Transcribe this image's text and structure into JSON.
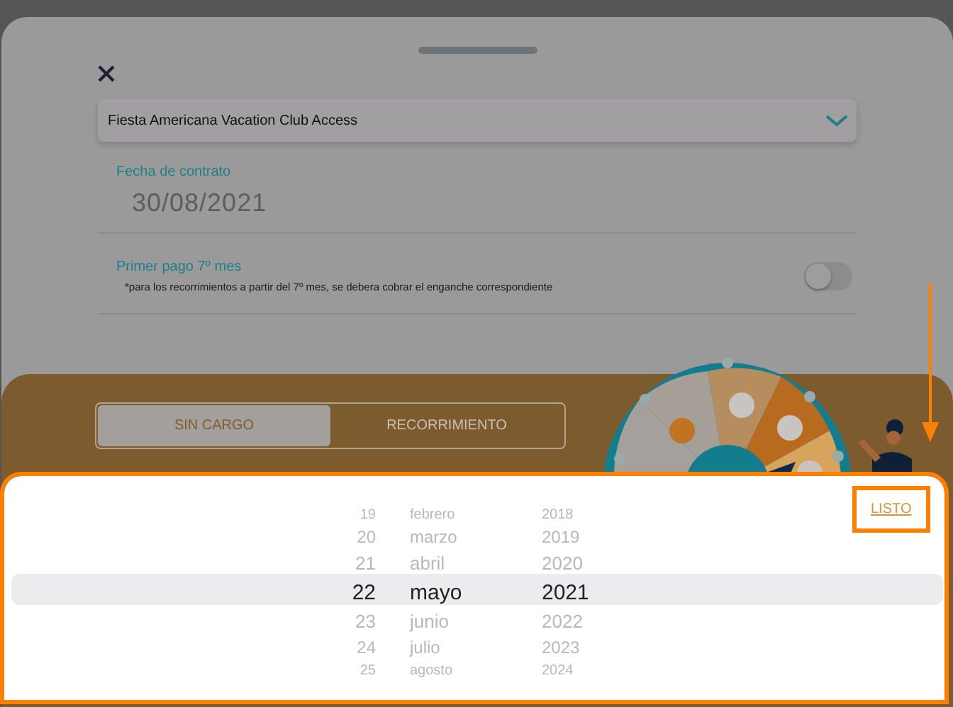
{
  "dropdown": {
    "value": "Fiesta Americana Vacation Club Access"
  },
  "contract_date": {
    "label": "Fecha de contrato",
    "value": "30/08/2021"
  },
  "first_payment": {
    "label": "Primer pago 7º mes",
    "note": "*para los recorrimientos a partir del 7º mes, se debera cobrar el enganche correspondiente",
    "on": false
  },
  "segments": [
    {
      "label": "SIN CARGO",
      "selected": true
    },
    {
      "label": "RECORRIMIENTO",
      "selected": false
    }
  ],
  "picker": {
    "done": "LISTO",
    "rows": [
      {
        "day": "19",
        "month": "febrero",
        "year": "2018",
        "selected": false
      },
      {
        "day": "20",
        "month": "marzo",
        "year": "2019",
        "selected": false
      },
      {
        "day": "21",
        "month": "abril",
        "year": "2020",
        "selected": false
      },
      {
        "day": "22",
        "month": "mayo",
        "year": "2021",
        "selected": true
      },
      {
        "day": "23",
        "month": "junio",
        "year": "2022",
        "selected": false
      },
      {
        "day": "24",
        "month": "julio",
        "year": "2023",
        "selected": false
      },
      {
        "day": "25",
        "month": "agosto",
        "year": "2024",
        "selected": false
      }
    ]
  }
}
